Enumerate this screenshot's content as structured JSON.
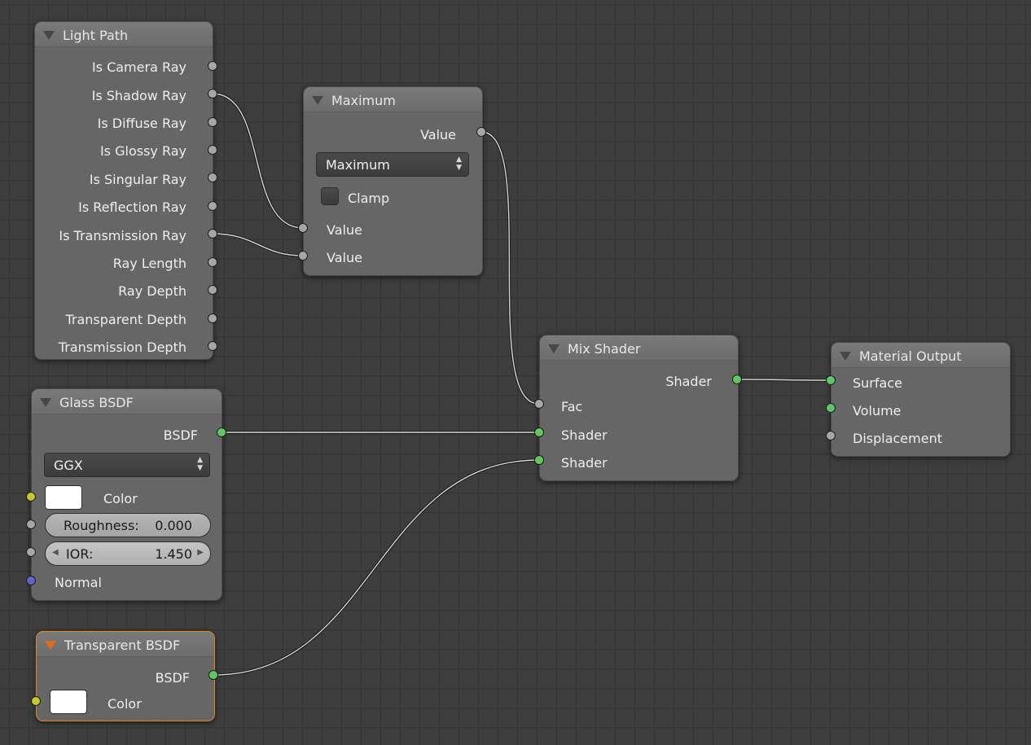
{
  "nodes": {
    "light_path": {
      "title": "Light Path",
      "outputs": [
        "Is Camera Ray",
        "Is Shadow Ray",
        "Is Diffuse Ray",
        "Is Glossy Ray",
        "Is Singular Ray",
        "Is Reflection Ray",
        "Is Transmission Ray",
        "Ray Length",
        "Ray Depth",
        "Transparent Depth",
        "Transmission Depth"
      ]
    },
    "maximum": {
      "title": "Maximum",
      "output": "Value",
      "operation": "Maximum",
      "clamp_label": "Clamp",
      "clamp_checked": false,
      "inputs": [
        "Value",
        "Value"
      ]
    },
    "mix_shader": {
      "title": "Mix Shader",
      "output": "Shader",
      "inputs": [
        "Fac",
        "Shader",
        "Shader"
      ]
    },
    "material_output": {
      "title": "Material Output",
      "inputs": [
        "Surface",
        "Volume",
        "Displacement"
      ]
    },
    "glass_bsdf": {
      "title": "Glass BSDF",
      "output": "BSDF",
      "distribution": "GGX",
      "color_label": "Color",
      "roughness_label": "Roughness:",
      "roughness_value": "0.000",
      "ior_label": "IOR:",
      "ior_value": "1.450",
      "normal_label": "Normal"
    },
    "transparent_bsdf": {
      "title": "Transparent BSDF",
      "output": "BSDF",
      "color_label": "Color",
      "active": true
    }
  },
  "colors": {
    "background": "#3d3d3d",
    "node_body": "#666666",
    "socket_shader": "#62c762",
    "socket_value": "#a6a6a6",
    "socket_color": "#c7c729",
    "socket_vector": "#6363c7",
    "active_outline": "#e8832a"
  }
}
